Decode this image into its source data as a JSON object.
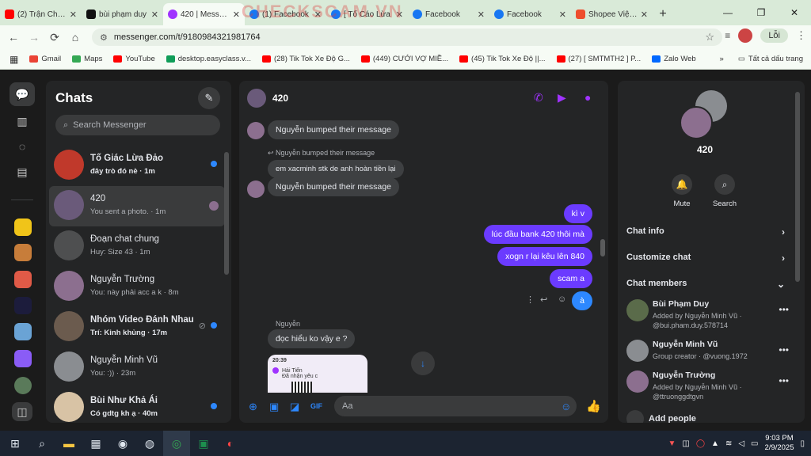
{
  "browser": {
    "tabs": [
      {
        "title": "(2) Trận Chiến",
        "color": "#ff0000"
      },
      {
        "title": "bùi phạm duy",
        "color": "#111111"
      },
      {
        "title": "420 | Messenger",
        "color": "#a033ff"
      },
      {
        "title": "(1) Facebook",
        "color": "#1877f2"
      },
      {
        "title": "[ Tố Cáo Lừa",
        "color": "#1877f2"
      },
      {
        "title": "Facebook",
        "color": "#1877f2"
      },
      {
        "title": "Facebook",
        "color": "#1877f2"
      },
      {
        "title": "Shopee Việt Nam",
        "color": "#ee4d2d"
      }
    ],
    "url": "messenger.com/t/9180984321981764",
    "profile_label": "Lỗi",
    "watermark": "CHECKSCAM.VN",
    "bookmarks": [
      {
        "label": "Gmail",
        "color": "#ea4335"
      },
      {
        "label": "Maps",
        "color": "#34a853"
      },
      {
        "label": "YouTube",
        "color": "#ff0000"
      },
      {
        "label": "desktop.easyclass.v...",
        "color": "#0f9d58"
      },
      {
        "label": "(28) Tik Tok Xe Độ G...",
        "color": "#ff0000"
      },
      {
        "label": "(449) CƯỚI VỢ MIỀ...",
        "color": "#ff0000"
      },
      {
        "label": "(45) Tik Tok Xe Độ ||...",
        "color": "#ff0000"
      },
      {
        "label": "(27) [ SMTMTH2 ] P...",
        "color": "#ff0000"
      },
      {
        "label": "Zalo Web",
        "color": "#0068ff"
      }
    ],
    "all_bookmarks": "Tất cả dấu trang"
  },
  "chats": {
    "title": "Chats",
    "search_placeholder": "Search Messenger",
    "items": [
      {
        "name": "Tố Giác Lừa Đảo",
        "preview": "đây trò đó nè · 1m",
        "unread": true,
        "color": "#c0392b"
      },
      {
        "name": "420",
        "preview": "You sent a photo. · 1m",
        "unread": false,
        "color": "#6a5a7a"
      },
      {
        "name": "Đoạn chat chung",
        "preview": "Huy: Size 43 · 1m",
        "unread": false,
        "color": "#4e4f50"
      },
      {
        "name": "Nguyễn Trường",
        "preview": "You: này phải acc a k · 8m",
        "unread": false,
        "color": "#8c6f8f"
      },
      {
        "name": "Nhóm Video Đánh Nhau",
        "preview": "Trí: Kinh khủng · 17m",
        "unread": true,
        "color": "#6b5b4e"
      },
      {
        "name": "Nguyễn Minh Vũ",
        "preview": "You: :)) · 23m",
        "unread": false,
        "color": "#8a8d91"
      },
      {
        "name": "Bùi Như Khả Ái",
        "preview": "Có gdtg kh ạ · 40m",
        "unread": true,
        "color": "#d8c3a5"
      }
    ]
  },
  "conversation": {
    "title": "420",
    "messages": [
      {
        "text": "Nguyễn bumped their message"
      },
      {
        "text": "Nguyễn bumped their message"
      },
      {
        "text": "em xacminh stk de anh hoàn tiền lại"
      },
      {
        "text": "Nguyễn bumped their message"
      },
      {
        "text": "kì v"
      },
      {
        "text": "lúc đầu bank 420 thôi mà"
      },
      {
        "text": "xogn r lại kêu lên 840"
      },
      {
        "text": "scam a"
      },
      {
        "text": "à"
      },
      {
        "text": "Nguyễn"
      },
      {
        "text": "đọc hiểu ko vậy e ?"
      }
    ],
    "photo_time": "20:39",
    "photo_name": "Hải Tiến",
    "photo_sub": "Đã nhận yêu c",
    "input_placeholder": "Aa"
  },
  "details": {
    "title": "420",
    "mute": "Mute",
    "search": "Search",
    "sections": [
      "Chat info",
      "Customize chat",
      "Chat members"
    ],
    "members": [
      {
        "name": "Bùi Phạm Duy",
        "sub": "Added by Nguyễn Minh Vũ · @bui.pham.duy.578714",
        "color": "#5a6b4a"
      },
      {
        "name": "Nguyễn Minh Vũ",
        "sub": "Group creator · @vuong.1972",
        "color": "#8a8d91"
      },
      {
        "name": "Nguyễn Trường",
        "sub": "Added by Nguyễn Minh Vũ · @ttruonggdtgvn",
        "color": "#8c6f8f"
      }
    ],
    "add_people": "Add people"
  },
  "taskbar": {
    "time": "9:03 PM",
    "date": "2/9/2025"
  }
}
